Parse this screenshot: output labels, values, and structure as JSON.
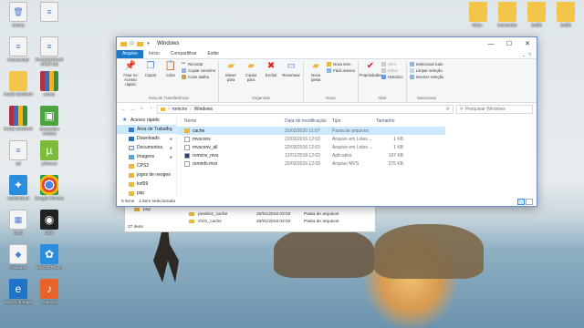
{
  "desktop": {
    "icons_left": [
      {
        "id": "recycle",
        "label": "Lixeira",
        "kind": "g-doc",
        "glyph": "🗑"
      },
      {
        "id": "d1",
        "label": "Xcutecompr",
        "kind": "g-doc",
        "glyph": "≡"
      },
      {
        "id": "d2",
        "label": "PUXE WINRAR",
        "kind": "g-folder",
        "glyph": ""
      },
      {
        "id": "d3",
        "label": "PUXE WINRAR",
        "kind": "g-zip",
        "glyph": ""
      },
      {
        "id": "d4",
        "label": "ad",
        "kind": "g-doc",
        "glyph": "≡"
      },
      {
        "id": "aether",
        "label": "Aetherclient",
        "kind": "g-app",
        "glyph": "✦"
      },
      {
        "id": "gta",
        "label": "Gta5",
        "kind": "g-doc",
        "glyph": "▦"
      },
      {
        "id": "ccleaner",
        "label": "CCleaner",
        "kind": "g-doc",
        "glyph": "◆"
      },
      {
        "id": "edge",
        "label": "Microsoft Edge",
        "kind": "g-edge",
        "glyph": "e"
      },
      {
        "id": "pdoc",
        "label": "",
        "kind": "g-doc",
        "glyph": "≡"
      },
      {
        "id": "pzip",
        "label": "PUXEWINRAR 4TUR M3",
        "kind": "g-doc",
        "glyph": "≡"
      },
      {
        "id": "winrar",
        "label": "winrar",
        "kind": "g-zip",
        "glyph": ""
      },
      {
        "id": "greenapp",
        "label": "Greenshot Actions",
        "kind": "g-green",
        "glyph": "▣"
      },
      {
        "id": "utorrent",
        "label": "µTorrent",
        "kind": "g-ut",
        "glyph": "µ"
      },
      {
        "id": "chrome",
        "label": "Google Chrome",
        "kind": "g-chrome",
        "glyph": ""
      },
      {
        "id": "obs",
        "label": "OBS",
        "kind": "g-obs",
        "glyph": "◉"
      },
      {
        "id": "sketch",
        "label": "MAGIX Photo",
        "kind": "g-app",
        "glyph": "✿"
      },
      {
        "id": "audacity",
        "label": "Audacity",
        "kind": "g-orange",
        "glyph": "♪"
      }
    ],
    "icons_right": [
      {
        "id": "r1",
        "label": "Hb1c..",
        "kind": "g-folder"
      },
      {
        "id": "r2",
        "label": "ttoacombe",
        "kind": "g-folder"
      },
      {
        "id": "r3",
        "label": "kof98",
        "kind": "g-folder"
      },
      {
        "id": "r4",
        "label": "kof98",
        "kind": "g-folder"
      }
    ]
  },
  "bg_window": {
    "rows": [
      {
        "name": "pnp",
        "date": "",
        "type": ""
      },
      {
        "name": "preisle2_cache",
        "date": "20/01/2018 03:03",
        "type": "Pasta de arquivos"
      },
      {
        "name": "ch01_cache",
        "date": "20/01/2018 03:03",
        "type": "Pasta de arquivos"
      }
    ],
    "status": "27 itens"
  },
  "explorer": {
    "title": "Windows",
    "tabs": [
      "Arquivo",
      "Início",
      "Compartilhar",
      "Exibir"
    ],
    "ribbon": {
      "clipboard": {
        "name": "Área de Transferência",
        "pin": "Fixar no Acesso rápido",
        "copy": "Copiar",
        "paste": "Colar",
        "cut": "Recortar",
        "copy_path": "Copiar caminho",
        "paste_shortcut": "Colar atalho"
      },
      "organize": {
        "name": "Organizar",
        "move": "Mover para",
        "copy_to": "Copiar para",
        "delete": "Excluir",
        "rename": "Renomear"
      },
      "new": {
        "name": "Novo",
        "new_folder": "Nova pasta",
        "new_item": "Novo item",
        "easy_access": "Fácil acesso"
      },
      "open": {
        "name": "Abrir",
        "properties": "Propriedades",
        "open": "Abrir",
        "edit": "Editar",
        "history": "Histórico"
      },
      "select": {
        "name": "Selecionar",
        "select_all": "Selecionar tudo",
        "select_none": "Limpar seleção",
        "invert": "Inverter seleção"
      }
    },
    "address": {
      "parts": [
        "romcnv",
        "Windows"
      ]
    },
    "search": {
      "placeholder": "Pesquisar Windows"
    },
    "nav_pane": [
      {
        "label": "Acesso rápido",
        "icon": "fi-star",
        "level": 1,
        "selected": false
      },
      {
        "label": "Área de Trabalho",
        "icon": "fi-blue",
        "level": 2,
        "selected": true
      },
      {
        "label": "Downloads",
        "icon": "fi-dl",
        "level": 2,
        "selected": false
      },
      {
        "label": "Documentos",
        "icon": "fi-doc",
        "level": 2,
        "selected": false
      },
      {
        "label": "Imagens",
        "icon": "fi-img",
        "level": 2,
        "selected": false
      },
      {
        "label": "CPS2",
        "icon": "fi-folder",
        "level": 2,
        "selected": false
      },
      {
        "label": "jogos de neogeo",
        "icon": "fi-folder",
        "level": 2,
        "selected": false
      },
      {
        "label": "kof99",
        "icon": "fi-folder",
        "level": 2,
        "selected": false
      },
      {
        "label": "psp",
        "icon": "fi-folder",
        "level": 2,
        "selected": false
      }
    ],
    "columns": {
      "name": "Nome",
      "date": "Data de modificação",
      "type": "Tipo",
      "size": "Tamanho"
    },
    "files": [
      {
        "name": "cache",
        "date": "31/03/2020 11:07",
        "type": "Pasta de arquivos",
        "size": "",
        "icon": "fic-folder",
        "selected": true
      },
      {
        "name": "mvsconv",
        "date": "22/03/2016 12:03",
        "type": "Arquivo em Lotes ...",
        "size": "1 KB",
        "icon": "fic-file",
        "selected": false
      },
      {
        "name": "mvsconv_all",
        "date": "22/03/2016 12:03",
        "type": "Arquivo em Lotes ...",
        "size": "1 KB",
        "icon": "fic-file",
        "selected": false
      },
      {
        "name": "romcnv_mvs",
        "date": "12/01/2018 12:03",
        "type": "Aplicativo",
        "size": "197 KB",
        "icon": "fic-app",
        "selected": false
      },
      {
        "name": "rominfo.mvs",
        "date": "22/03/2016 12:03",
        "type": "Arquivo MVS",
        "size": "275 KB",
        "icon": "fic-file",
        "selected": false
      }
    ],
    "status": {
      "count": "5 itens",
      "selected": "1 item selecionado"
    }
  }
}
